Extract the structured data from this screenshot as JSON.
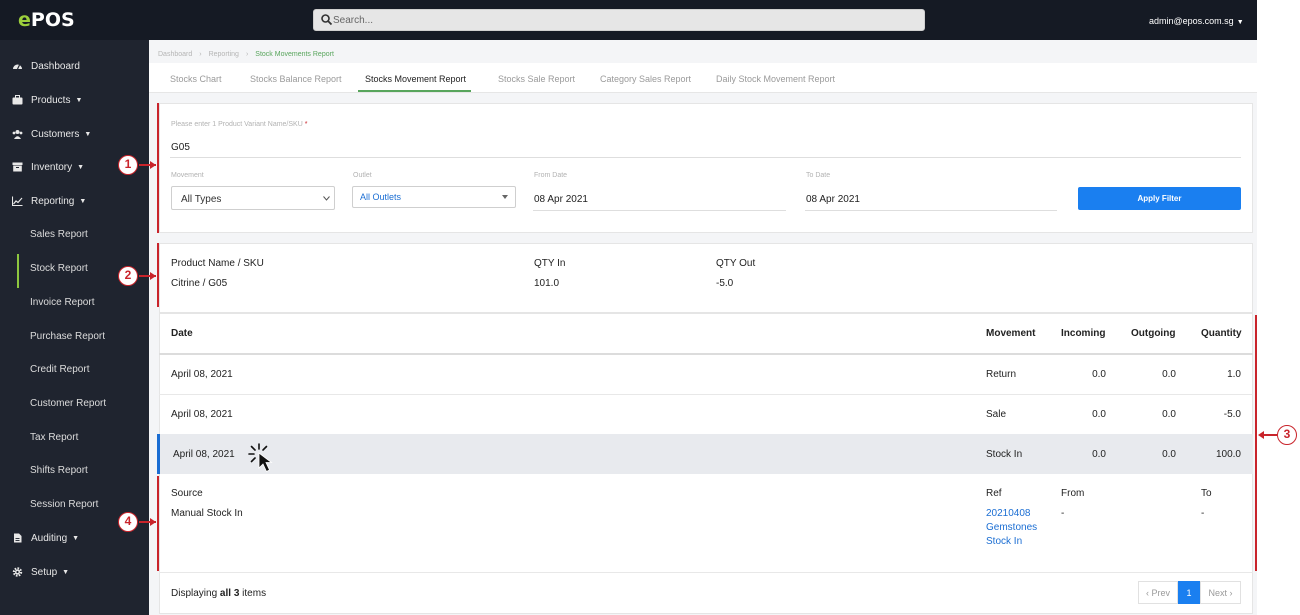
{
  "topbar": {
    "logo_e": "e",
    "logo_rest": "POS",
    "search_placeholder": "Search...",
    "user": "admin@epos.com.sg"
  },
  "sidebar": {
    "dashboard": "Dashboard",
    "products": "Products",
    "customers": "Customers",
    "inventory": "Inventory",
    "reporting": "Reporting",
    "sales_report": "Sales Report",
    "stock_report": "Stock Report",
    "invoice_report": "Invoice Report",
    "purchase_report": "Purchase Report",
    "credit_report": "Credit Report",
    "customer_report": "Customer Report",
    "tax_report": "Tax Report",
    "shifts_report": "Shifts Report",
    "session_report": "Session Report",
    "auditing": "Auditing",
    "setup": "Setup"
  },
  "breadcrumb": {
    "dashboard": "Dashboard",
    "reporting": "Reporting",
    "current": "Stock Movements Report"
  },
  "tabs": {
    "stocks_chart": "Stocks Chart",
    "stocks_balance": "Stocks Balance Report",
    "stocks_movement": "Stocks Movement Report",
    "stocks_sale": "Stocks Sale Report",
    "category_sales": "Category Sales Report",
    "daily_stock": "Daily Stock Movement Report"
  },
  "filter": {
    "product_label": "Please enter 1 Product Variant Name/SKU",
    "product_required": "*",
    "product_value": "G05",
    "movement_label": "Movement",
    "movement_value": "All Types",
    "outlet_label": "Outlet",
    "outlet_value": "All Outlets",
    "from_label": "From Date",
    "from_value": "08 Apr 2021",
    "to_label": "To Date",
    "to_value": "08 Apr 2021",
    "apply": "Apply Filter"
  },
  "summary": {
    "col_product": "Product Name / SKU",
    "col_qty_in": "QTY In",
    "col_qty_out": "QTY Out",
    "product": "Citrine / G05",
    "qty_in": "101.0",
    "qty_out": "-5.0"
  },
  "table": {
    "headers": {
      "date": "Date",
      "movement": "Movement",
      "incoming": "Incoming",
      "outgoing": "Outgoing",
      "quantity": "Quantity"
    },
    "rows": [
      {
        "date": "April 08, 2021",
        "movement": "Return",
        "incoming": "0.0",
        "outgoing": "0.0",
        "quantity": "1.0"
      },
      {
        "date": "April 08, 2021",
        "movement": "Sale",
        "incoming": "0.0",
        "outgoing": "0.0",
        "quantity": "-5.0"
      },
      {
        "date": "April 08, 2021",
        "movement": "Stock In",
        "incoming": "0.0",
        "outgoing": "0.0",
        "quantity": "100.0"
      }
    ]
  },
  "detail": {
    "source_label": "Source",
    "source_value": "Manual Stock In",
    "ref_label": "Ref",
    "ref_line1": "20210408",
    "ref_line2": "Gemstones",
    "ref_line3": "Stock In",
    "from_label": "From",
    "from_value": "-",
    "to_label": "To",
    "to_value": "-"
  },
  "footer": {
    "displaying": "Displaying",
    "all_3": "all 3",
    "items": "items",
    "prev": "‹ Prev",
    "page": "1",
    "next": "Next ›"
  },
  "callouts": [
    "1",
    "2",
    "3",
    "4"
  ],
  "colors": {
    "topbar": "#151a24",
    "sidebar": "#1f242f",
    "accent_green": "#58a55c",
    "button_blue": "#1a7ff0",
    "callout_red": "#c9242b",
    "selected_row": "#e8eaee",
    "selected_row_bar": "#1b6ed3"
  }
}
